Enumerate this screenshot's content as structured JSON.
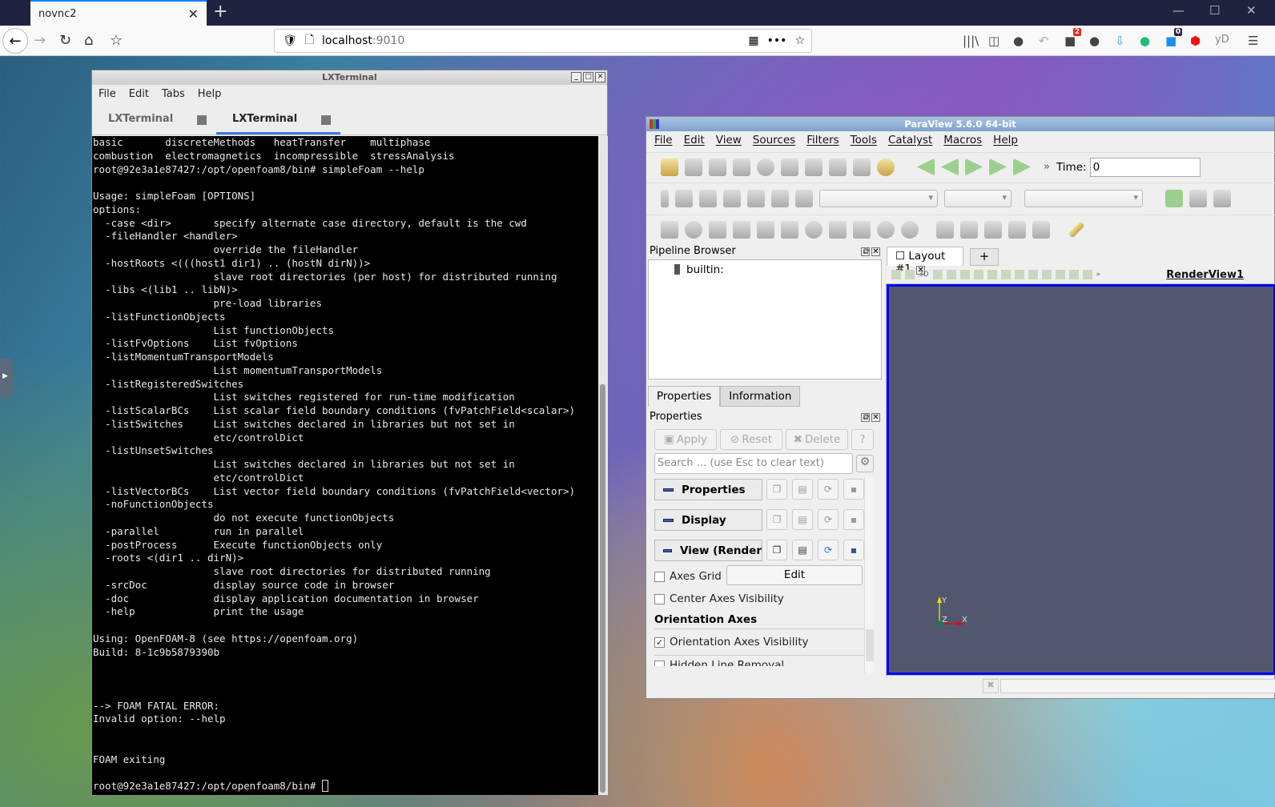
{
  "browser": {
    "tab_title": "novnc2",
    "url_host": "localhost",
    "url_port": ":9010",
    "badge_red": "2",
    "badge_purple": "0",
    "ext_yd": "yD"
  },
  "terminal": {
    "window_title": "LXTerminal",
    "menu": [
      "File",
      "Edit",
      "Tabs",
      "Help"
    ],
    "tabs": [
      "LXTerminal",
      "LXTerminal"
    ],
    "lines": [
      "basic       discreteMethods   heatTransfer    multiphase",
      "combustion  electromagnetics  incompressible  stressAnalysis",
      "root@92e3a1e87427:/opt/openfoam8/bin# simpleFoam --help",
      "",
      "Usage: simpleFoam [OPTIONS]",
      "options:",
      "  -case <dir>       specify alternate case directory, default is the cwd",
      "  -fileHandler <handler>",
      "                    override the fileHandler",
      "  -hostRoots <(((host1 dir1) .. (hostN dirN))>",
      "                    slave root directories (per host) for distributed running",
      "  -libs <(lib1 .. libN)>",
      "                    pre-load libraries",
      "  -listFunctionObjects",
      "                    List functionObjects",
      "  -listFvOptions    List fvOptions",
      "  -listMomentumTransportModels",
      "                    List momentumTransportModels",
      "  -listRegisteredSwitches",
      "                    List switches registered for run-time modification",
      "  -listScalarBCs    List scalar field boundary conditions (fvPatchField<scalar>)",
      "  -listSwitches     List switches declared in libraries but not set in",
      "                    etc/controlDict",
      "  -listUnsetSwitches",
      "                    List switches declared in libraries but not set in",
      "                    etc/controlDict",
      "  -listVectorBCs    List vector field boundary conditions (fvPatchField<vector>)",
      "  -noFunctionObjects",
      "                    do not execute functionObjects",
      "  -parallel         run in parallel",
      "  -postProcess      Execute functionObjects only",
      "  -roots <(dir1 .. dirN)>",
      "                    slave root directories for distributed running",
      "  -srcDoc           display source code in browser",
      "  -doc              display application documentation in browser",
      "  -help             print the usage",
      "",
      "Using: OpenFOAM-8 (see https://openfoam.org)",
      "Build: 8-1c9b5879390b",
      "",
      "",
      "",
      "--> FOAM FATAL ERROR:",
      "Invalid option: --help",
      "",
      "",
      "FOAM exiting",
      "",
      "root@92e3a1e87427:/opt/openfoam8/bin# "
    ]
  },
  "paraview": {
    "window_title": "ParaView 5.6.0 64-bit",
    "menu": [
      "File",
      "Edit",
      "View",
      "Sources",
      "Filters",
      "Tools",
      "Catalyst",
      "Macros",
      "Help"
    ],
    "time_label": "Time:",
    "time_value": "0",
    "pipeline_title": "Pipeline Browser",
    "pipeline_item": "builtin:",
    "panel_tabs": [
      "Properties",
      "Information"
    ],
    "properties_title": "Properties",
    "buttons": {
      "apply": "Apply",
      "reset": "Reset",
      "delete": "Delete",
      "help": "?"
    },
    "search_placeholder": "Search ... (use Esc to clear text)",
    "sections": [
      "Properties",
      "Display",
      "View (Render"
    ],
    "axes_grid": "Axes Grid",
    "edit": "Edit",
    "center_axes": "Center Axes Visibility",
    "orientation_header": "Orientation Axes",
    "orientation_visibility": "Orientation Axes Visibility",
    "orientation_checked": true,
    "hidden_line": "Hidden Line Removal",
    "layout_tab": "Layout #1",
    "add_tab": "+",
    "view_3d": "3D",
    "render_view": "RenderView1",
    "axis_labels": {
      "x": "X",
      "y": "Y",
      "z": "Z"
    }
  }
}
